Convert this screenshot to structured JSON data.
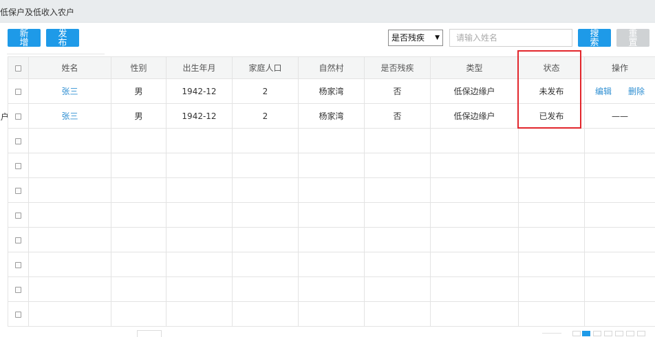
{
  "header": {
    "title": "低保户及低收入农户"
  },
  "toolbar": {
    "add_label_1": "新",
    "add_label_2": "增",
    "publish_label_1": "发",
    "publish_label_2": "布",
    "search_label_1": "搜",
    "search_label_2": "索",
    "reset_label_1": "重",
    "reset_label_2": "置"
  },
  "filter": {
    "disabled_select": "是否残疾",
    "name_placeholder": "请输入姓名"
  },
  "side_text": "农户",
  "table": {
    "columns": [
      "姓名",
      "性别",
      "出生年月",
      "家庭人口",
      "自然村",
      "是否残疾",
      "类型",
      "状态",
      "操作"
    ],
    "rows": [
      {
        "name": "张三",
        "gender": "男",
        "birth": "1942-12",
        "family": "2",
        "village": "杨家湾",
        "disabled": "否",
        "type": "低保边缘户",
        "status": "未发布",
        "op_edit": "编辑",
        "op_delete": "删除"
      },
      {
        "name": "张三",
        "gender": "男",
        "birth": "1942-12",
        "family": "2",
        "village": "杨家湾",
        "disabled": "否",
        "type": "低保边缘户",
        "status": "已发布",
        "op_none": "——"
      }
    ]
  },
  "colors": {
    "accent": "#1e9ae8",
    "highlight": "#e2252b",
    "link": "#2f8fd2"
  }
}
